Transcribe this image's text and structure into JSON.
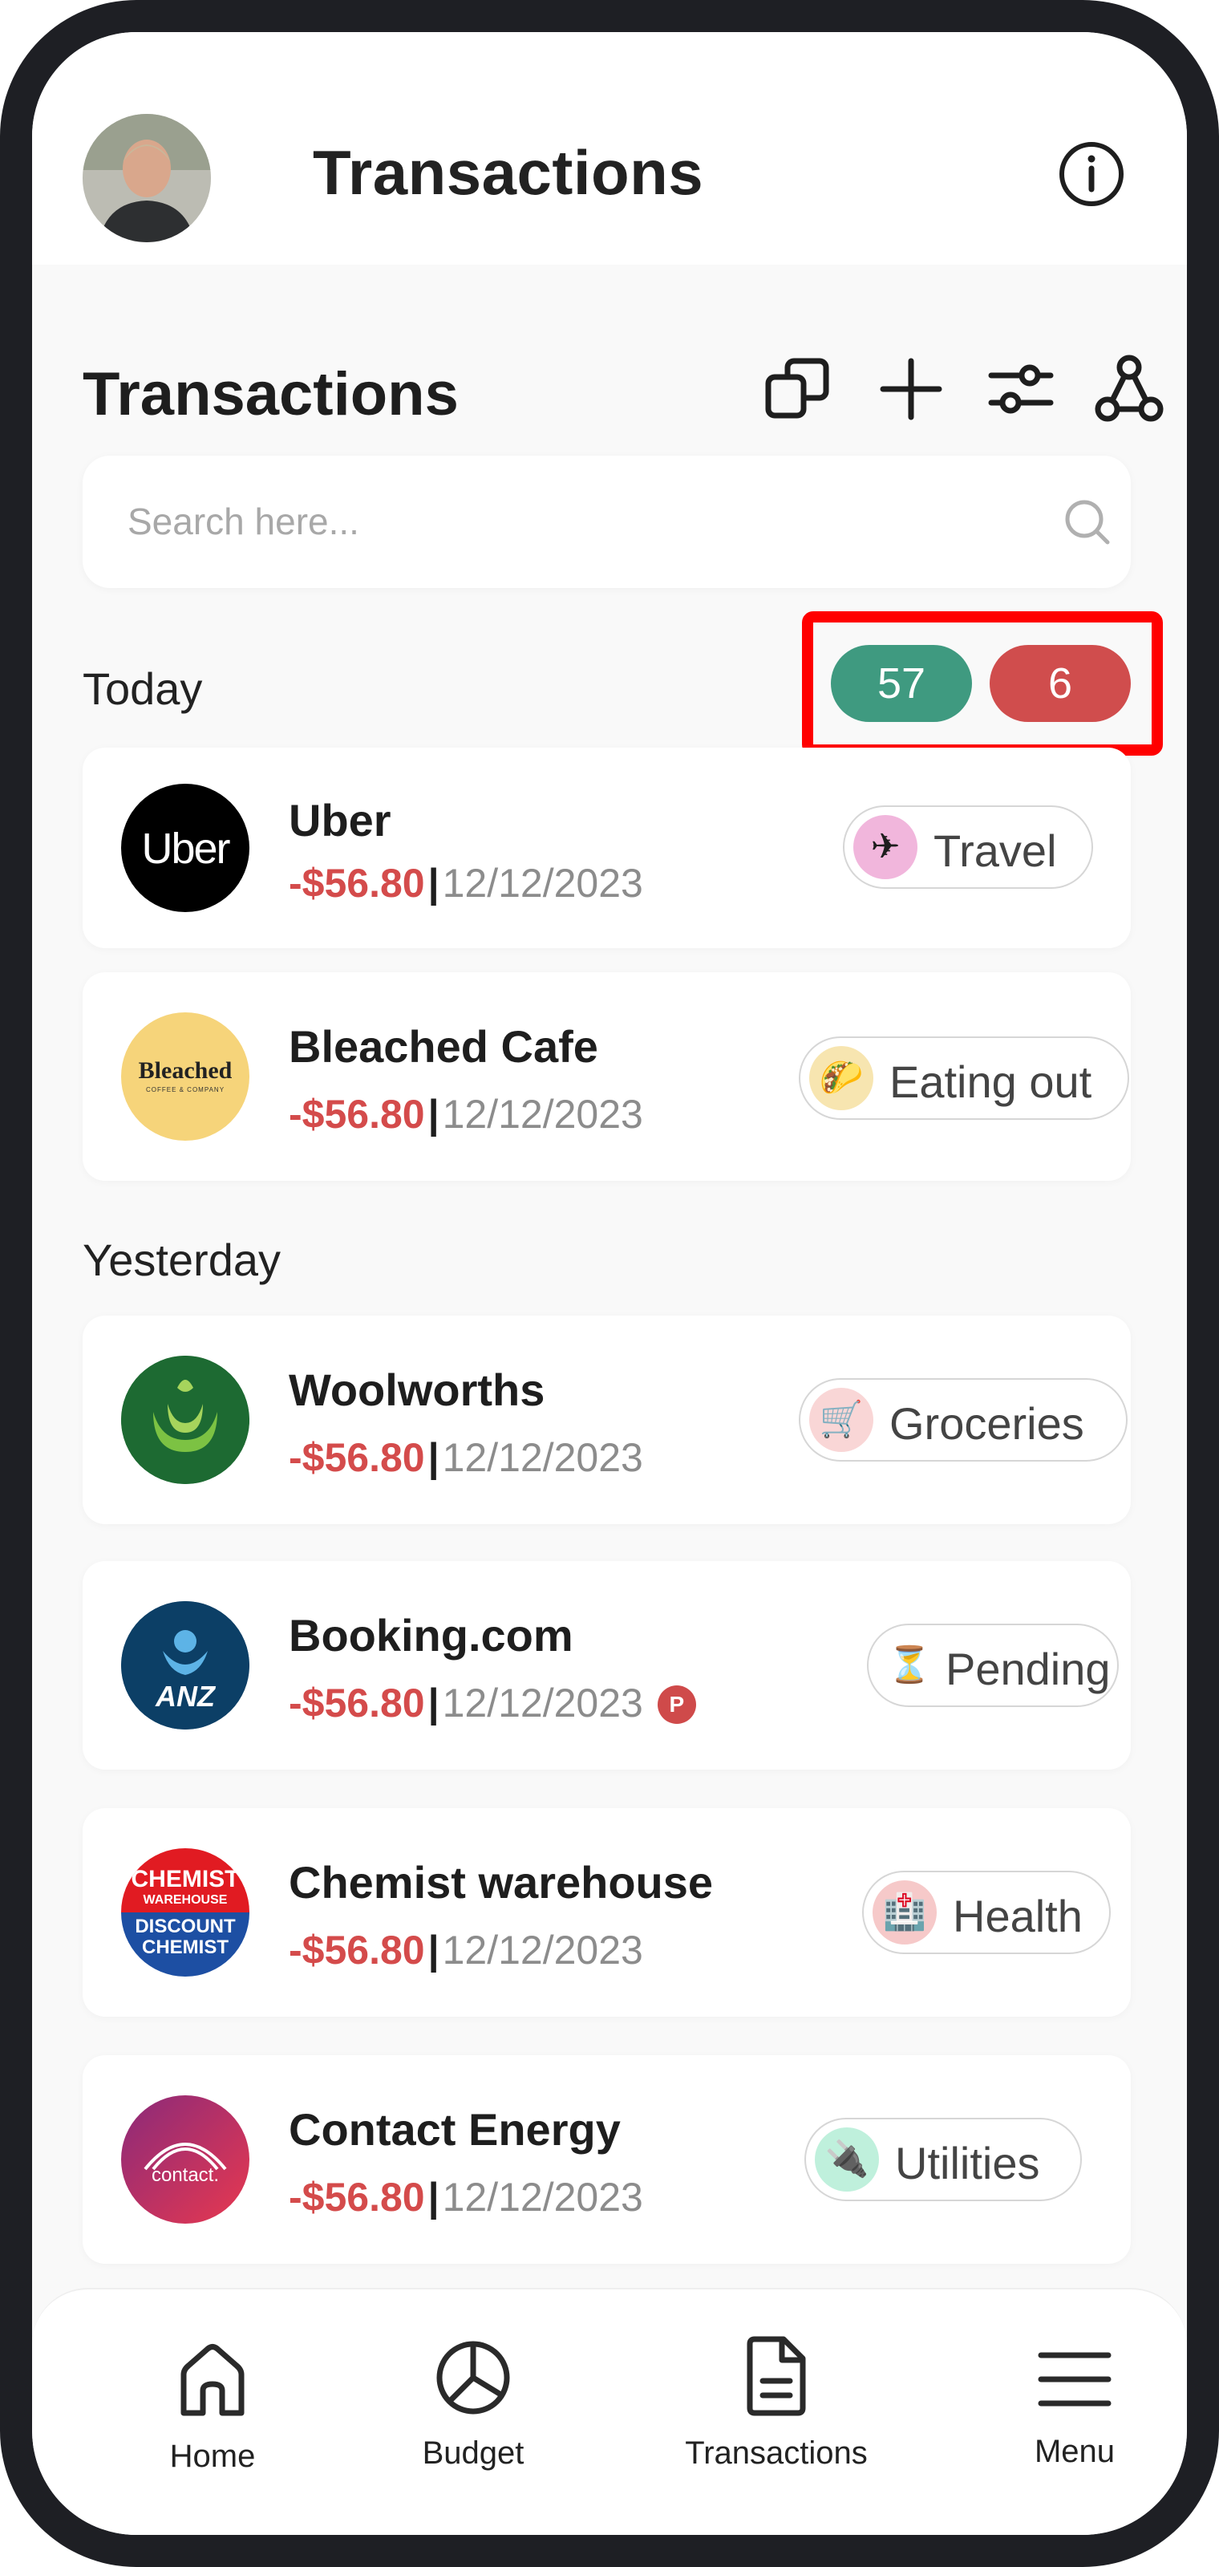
{
  "header": {
    "title": "Transactions",
    "info_icon": "info-icon",
    "avatar_icon": "user-avatar"
  },
  "section": {
    "title": "Transactions",
    "actions": [
      {
        "name": "copy-icon"
      },
      {
        "name": "plus-icon"
      },
      {
        "name": "sliders-icon"
      },
      {
        "name": "share-network-icon"
      }
    ]
  },
  "search": {
    "placeholder": "Search here..."
  },
  "counts": {
    "green": "57",
    "red": "6",
    "green_color": "#3f9a80",
    "red_color": "#d04d4d"
  },
  "groups": {
    "today": "Today",
    "yesterday": "Yesterday"
  },
  "transactions": [
    {
      "merchant": "Uber",
      "amount": "-$56.80",
      "date": "12/12/2023",
      "category": "Travel",
      "category_icon": "airplane-icon",
      "logo_text": "Uber"
    },
    {
      "merchant": "Bleached Cafe",
      "amount": "-$56.80",
      "date": "12/12/2023",
      "category": "Eating out",
      "category_icon": "taco-icon",
      "logo_text": "Bleached",
      "logo_subtext": "COFFEE & COMPANY"
    },
    {
      "merchant": "Woolworths",
      "amount": "-$56.80",
      "date": "12/12/2023",
      "category": "Groceries",
      "category_icon": "cart-icon"
    },
    {
      "merchant": "Booking.com",
      "amount": "-$56.80",
      "date": "12/12/2023",
      "badge": "P",
      "category": "Pending",
      "category_icon": "hourglass-icon",
      "logo_text": "ANZ"
    },
    {
      "merchant": "Chemist warehouse",
      "amount": "-$56.80",
      "date": "12/12/2023",
      "category": "Health",
      "category_icon": "hospital-icon",
      "logo_text": "CHEMIST",
      "logo_text2": "WAREHOUSE",
      "logo_text3": "DISCOUNT",
      "logo_text4": "CHEMIST"
    },
    {
      "merchant": "Contact Energy",
      "amount": "-$56.80",
      "date": "12/12/2023",
      "category": "Utilities",
      "category_icon": "plug-icon",
      "logo_text": "contact."
    }
  ],
  "bottom_nav": [
    {
      "label": "Home",
      "icon": "home-icon"
    },
    {
      "label": "Budget",
      "icon": "pie-chart-icon"
    },
    {
      "label": "Transactions",
      "icon": "document-icon"
    },
    {
      "label": "Menu",
      "icon": "menu-icon"
    }
  ]
}
